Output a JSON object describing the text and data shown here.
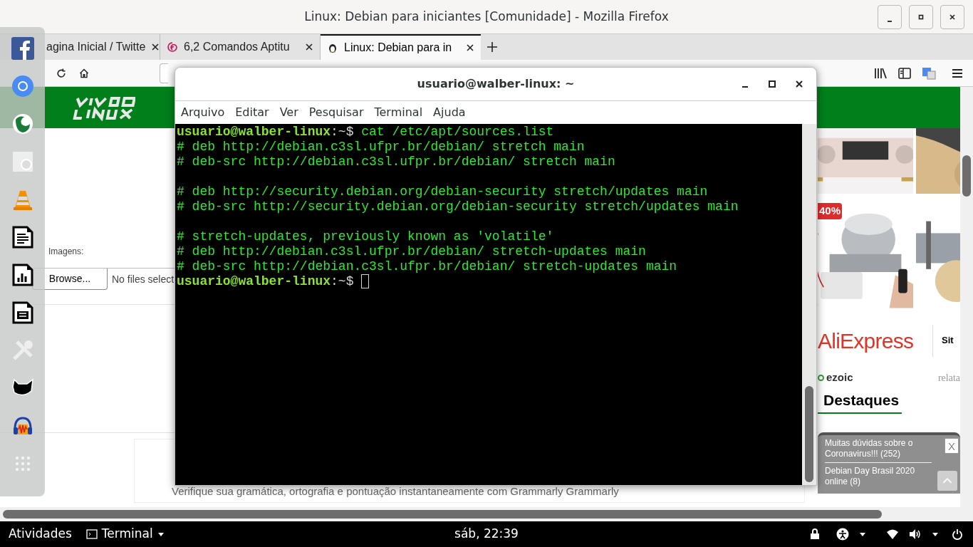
{
  "window": {
    "title": "Linux: Debian para iniciantes [Comunidade] - Mozilla Firefox"
  },
  "tabs": [
    {
      "label": "agina Inicial / Twitte",
      "selected": false
    },
    {
      "label": "6,2 Comandos Aptitu",
      "selected": false
    },
    {
      "label": "Linux: Debian para in",
      "selected": true
    }
  ],
  "page": {
    "form": {
      "label": "Imagens:",
      "browse_button": "Browse...",
      "file_status": "No files select"
    },
    "ad_text": "Verifique sua gramática, ortografia e pontuação instantaneamente com Grammarly Grammarly",
    "discount_badge": "40%",
    "store_logo": "AliExpress",
    "side_text": "Sit",
    "ad_network": "ezoic",
    "cut_text": "relata",
    "section_title": "Destaques",
    "popup": {
      "links": [
        "Muitas dúvidas sobre o Coronavirus!!! (252)",
        "Debian Day Brasil 2020 online (8)"
      ],
      "close": "X"
    }
  },
  "terminal": {
    "title": "usuario@walber-linux: ~",
    "menu": [
      "Arquivo",
      "Editar",
      "Ver",
      "Pesquisar",
      "Terminal",
      "Ajuda"
    ],
    "lines": [
      {
        "kind": "prompt",
        "user_host": "usuario@walber-linux",
        "path": ":~$",
        "command": "cat /etc/apt/sources.list",
        "cursor": false
      },
      {
        "kind": "output",
        "text": "# deb http://debian.c3sl.ufpr.br/debian/ stretch main"
      },
      {
        "kind": "output",
        "text": "# deb-src http://debian.c3sl.ufpr.br/debian/ stretch main"
      },
      {
        "kind": "blank"
      },
      {
        "kind": "output",
        "text": "# deb http://security.debian.org/debian-security stretch/updates main"
      },
      {
        "kind": "output",
        "text": "# deb-src http://security.debian.org/debian-security stretch/updates main"
      },
      {
        "kind": "blank"
      },
      {
        "kind": "output",
        "text": "# stretch-updates, previously known as 'volatile'"
      },
      {
        "kind": "output",
        "text": "# deb http://debian.c3sl.ufpr.br/debian/ stretch-updates main"
      },
      {
        "kind": "output",
        "text": "# deb-src http://debian.c3sl.ufpr.br/debian/ stretch-updates main"
      },
      {
        "kind": "prompt",
        "user_host": "usuario@walber-linux",
        "path": ":~$",
        "cursor": true
      }
    ]
  },
  "top_bar": {
    "activities": "Atividades",
    "app": "Terminal",
    "clock": "sáb, 22:39"
  }
}
